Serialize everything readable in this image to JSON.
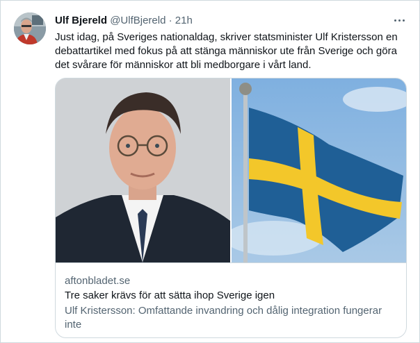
{
  "tweet": {
    "author_name": "Ulf Bjereld",
    "handle": "@UlfBjereld",
    "separator": "·",
    "time": "21h",
    "text": "Just idag, på Sveriges nationaldag, skriver statsminister Ulf Kristersson en debattartikel med fokus på att stänga människor ute från Sverige och göra det svårare för människor att bli medborgare i vårt land."
  },
  "card": {
    "domain": "aftonbladet.se",
    "title": "Tre saker krävs för att sätta ihop Sverige igen",
    "description": "Ulf Kristersson: Omfattande invandring och dålig integration fungerar inte"
  },
  "icons": {
    "more": "more-horizontal-icon",
    "avatar": "avatar-photo",
    "portrait": "portrait-photo",
    "flag": "swedish-flag-photo"
  },
  "colors": {
    "text": "#0f1419",
    "muted": "#536471",
    "border": "#cfd9de",
    "flag_blue": "#1f5f96",
    "flag_yellow": "#f3c72a"
  }
}
